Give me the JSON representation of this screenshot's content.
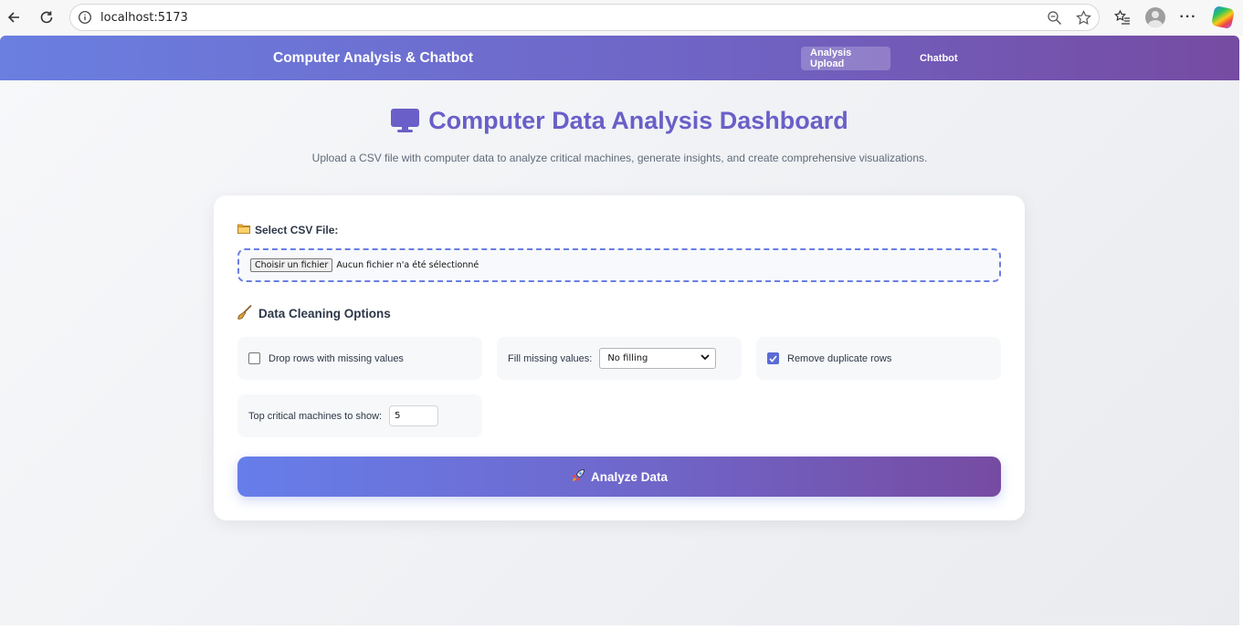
{
  "browser": {
    "url": "localhost:5173"
  },
  "app": {
    "title": "Computer Analysis & Chatbot",
    "nav": [
      {
        "label": "Analysis Upload",
        "active": true
      },
      {
        "label": "Chatbot",
        "active": false
      }
    ]
  },
  "page": {
    "title": "Computer Data Analysis Dashboard",
    "subtitle": "Upload a CSV file with computer data to analyze critical machines, generate insights, and create comprehensive visualizations."
  },
  "upload": {
    "label": "Select CSV File:",
    "button_label": "Choisir un fichier",
    "status": "Aucun fichier n'a été sélectionné"
  },
  "cleaning": {
    "title": "Data Cleaning Options",
    "drop_missing": {
      "label": "Drop rows with missing values",
      "checked": false
    },
    "fill_missing": {
      "label": "Fill missing values:",
      "selected": "No filling"
    },
    "remove_duplicates": {
      "label": "Remove duplicate rows",
      "checked": true
    },
    "top_critical": {
      "label": "Top critical machines to show:",
      "value": "5"
    }
  },
  "analyze": {
    "label": "Analyze Data"
  },
  "colors": {
    "accent": "#667eea",
    "accent_end": "#764ba2",
    "title": "#6a5fc8"
  }
}
